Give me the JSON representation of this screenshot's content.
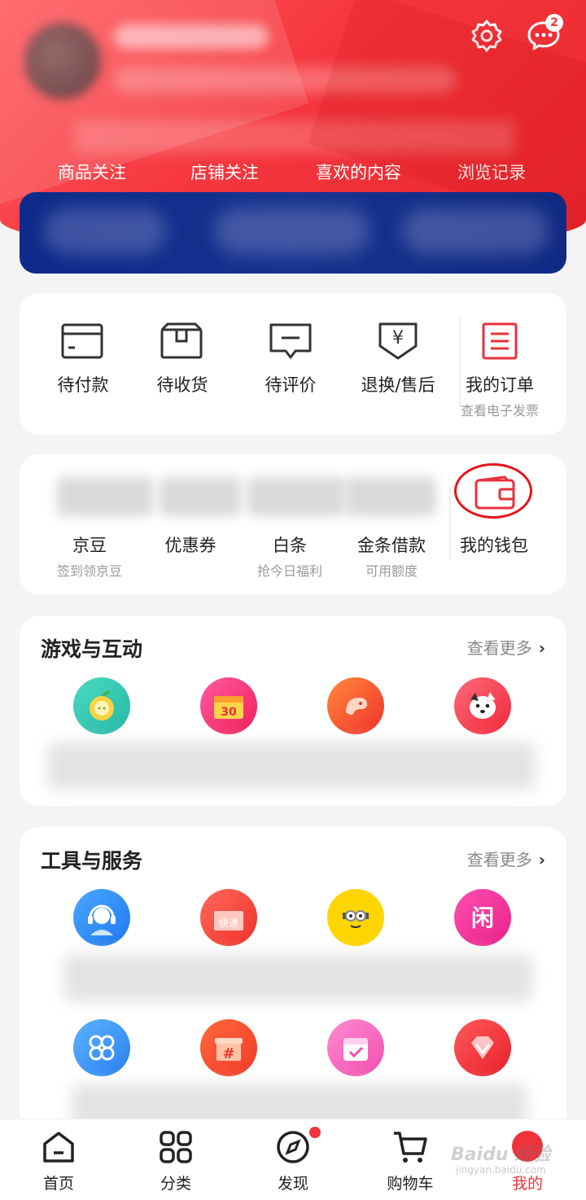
{
  "header": {
    "follow_items": [
      "商品关注",
      "店铺关注",
      "喜欢的内容",
      "浏览记录"
    ],
    "message_badge": "2",
    "accent": "#f0323a",
    "icons": [
      "gear-icon",
      "chat-icon"
    ]
  },
  "orders": {
    "items": [
      {
        "label": "待付款",
        "icon": "card-icon"
      },
      {
        "label": "待收货",
        "icon": "box-icon"
      },
      {
        "label": "待评价",
        "icon": "comment-icon"
      },
      {
        "label": "退换/售后",
        "icon": "refund-icon"
      },
      {
        "label": "我的订单",
        "sub": "查看电子发票",
        "icon": "order-list-icon"
      }
    ]
  },
  "assets": {
    "items": [
      {
        "label": "京豆",
        "sub": "签到领京豆"
      },
      {
        "label": "优惠券",
        "sub": ""
      },
      {
        "label": "白条",
        "sub": "抢今日福利"
      },
      {
        "label": "金条借款",
        "sub": "可用额度"
      },
      {
        "label": "我的钱包",
        "sub": "",
        "icon": "wallet-icon"
      }
    ]
  },
  "games": {
    "title": "游戏与互动",
    "more": "查看更多",
    "icons": [
      "apple-icon",
      "calendar-30-icon",
      "bird-icon",
      "puppy-icon"
    ]
  },
  "tools": {
    "title": "工具与服务",
    "more": "查看更多",
    "icons_row1": [
      "customer-service-icon",
      "express-icon",
      "minion-icon",
      "idle-icon"
    ],
    "express_text": "快递",
    "idle_text": "闲",
    "icons_row2": [
      "knot-icon",
      "gift-hash-icon",
      "calendar-check-icon",
      "diamond-icon"
    ]
  },
  "tabbar": {
    "items": [
      {
        "label": "首页",
        "icon": "home-icon"
      },
      {
        "label": "分类",
        "icon": "grid-icon"
      },
      {
        "label": "发现",
        "icon": "compass-icon"
      },
      {
        "label": "购物车",
        "icon": "cart-icon"
      },
      {
        "label": "我的",
        "icon": "profile-icon",
        "active": true
      }
    ]
  },
  "watermark": {
    "text": "Baidu 经验",
    "sub": "jingyan.baidu.com"
  }
}
